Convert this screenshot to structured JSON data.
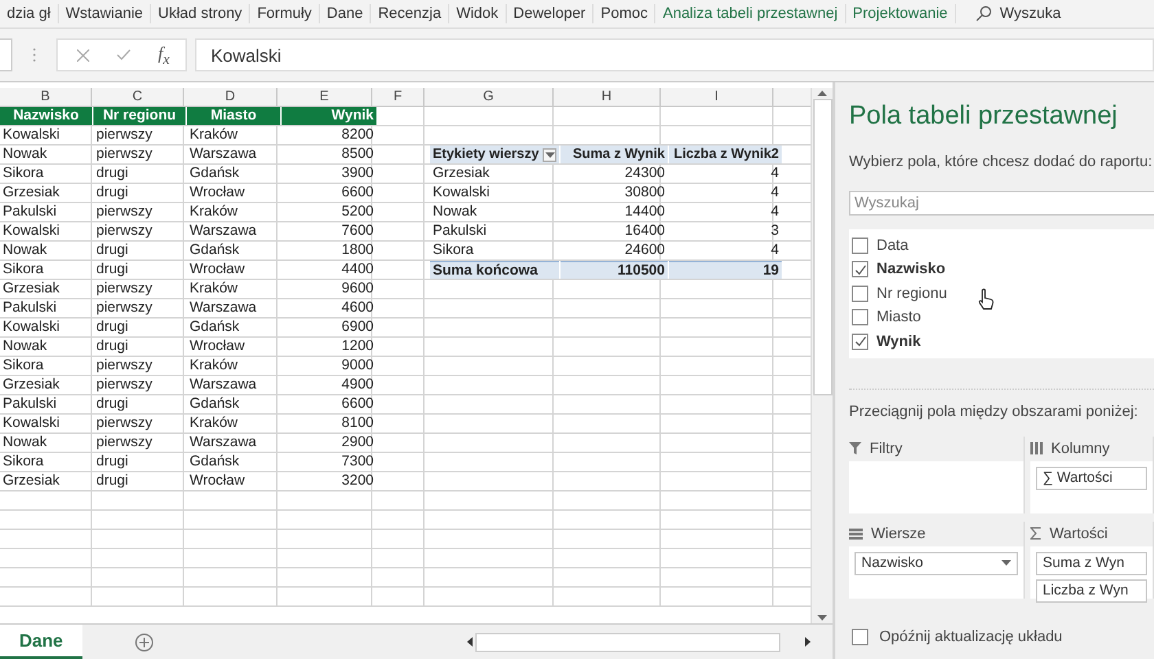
{
  "ribbon_tabs": [
    {
      "label": "dzia gł",
      "kind": "normal"
    },
    {
      "label": "Wstawianie",
      "kind": "normal"
    },
    {
      "label": "Układ strony",
      "kind": "normal"
    },
    {
      "label": "Formuły",
      "kind": "normal"
    },
    {
      "label": "Dane",
      "kind": "normal"
    },
    {
      "label": "Recenzja",
      "kind": "normal"
    },
    {
      "label": "Widok",
      "kind": "normal"
    },
    {
      "label": "Deweloper",
      "kind": "normal"
    },
    {
      "label": "Pomoc",
      "kind": "normal"
    },
    {
      "label": "Analiza tabeli przestawnej",
      "kind": "contextual"
    },
    {
      "label": "Projektowanie",
      "kind": "contextual"
    }
  ],
  "ribbon_search": {
    "label": "Wyszuka"
  },
  "formula_bar": {
    "function_label": "f$_{x}$",
    "value": "Kowalski"
  },
  "sheet": {
    "columns": [
      "B",
      "C",
      "D",
      "E",
      "F",
      "G",
      "H",
      "I"
    ],
    "header": [
      "Nazwisko",
      "Nr regionu",
      "Miasto",
      "Wynik"
    ],
    "rows": [
      [
        "Kowalski",
        "pierwszy",
        "Kraków",
        "8200"
      ],
      [
        "Nowak",
        "pierwszy",
        "Warszawa",
        "8500"
      ],
      [
        "Sikora",
        "drugi",
        "Gdańsk",
        "3900"
      ],
      [
        "Grzesiak",
        "drugi",
        "Wrocław",
        "6600"
      ],
      [
        "Pakulski",
        "pierwszy",
        "Kraków",
        "5200"
      ],
      [
        "Kowalski",
        "pierwszy",
        "Warszawa",
        "7600"
      ],
      [
        "Nowak",
        "drugi",
        "Gdańsk",
        "1800"
      ],
      [
        "Sikora",
        "drugi",
        "Wrocław",
        "4400"
      ],
      [
        "Grzesiak",
        "pierwszy",
        "Kraków",
        "9600"
      ],
      [
        "Pakulski",
        "pierwszy",
        "Warszawa",
        "4600"
      ],
      [
        "Kowalski",
        "drugi",
        "Gdańsk",
        "6900"
      ],
      [
        "Nowak",
        "drugi",
        "Wrocław",
        "1200"
      ],
      [
        "Sikora",
        "pierwszy",
        "Kraków",
        "9000"
      ],
      [
        "Grzesiak",
        "pierwszy",
        "Warszawa",
        "4900"
      ],
      [
        "Pakulski",
        "drugi",
        "Gdańsk",
        "6600"
      ],
      [
        "Kowalski",
        "pierwszy",
        "Kraków",
        "8100"
      ],
      [
        "Nowak",
        "pierwszy",
        "Warszawa",
        "2900"
      ],
      [
        "Sikora",
        "drugi",
        "Gdańsk",
        "7300"
      ],
      [
        "Grzesiak",
        "drugi",
        "Wrocław",
        "3200"
      ]
    ]
  },
  "pivot": {
    "columns": [
      "Etykiety wierszy",
      "Suma z Wynik",
      "Liczba z Wynik2"
    ],
    "rows": [
      {
        "label": "Grzesiak",
        "values": [
          "24300",
          "4"
        ]
      },
      {
        "label": "Kowalski",
        "values": [
          "30800",
          "4"
        ]
      },
      {
        "label": "Nowak",
        "values": [
          "14400",
          "4"
        ]
      },
      {
        "label": "Pakulski",
        "values": [
          "16400",
          "3"
        ]
      },
      {
        "label": "Sikora",
        "values": [
          "24600",
          "4"
        ]
      }
    ],
    "total": {
      "label": "Suma końcowa",
      "values": [
        "110500",
        "19"
      ]
    }
  },
  "sheet_tabs": [
    {
      "label": "Dane",
      "selected": true
    }
  ],
  "panel": {
    "title": "Pola tabeli przestawnej",
    "subtitle": "Wybierz pola, które chcesz dodać do raportu:",
    "search": {
      "placeholder": "Wyszukaj"
    },
    "fields": [
      {
        "label": "Data",
        "checked": false
      },
      {
        "label": "Nazwisko",
        "checked": true
      },
      {
        "label": "Nr regionu",
        "checked": false
      },
      {
        "label": "Miasto",
        "checked": false
      },
      {
        "label": "Wynik",
        "checked": true
      }
    ],
    "drag_hint": "Przeciągnij pola między obszarami poniżej:",
    "areas": [
      {
        "kind": "filters",
        "label": "Filtry"
      },
      {
        "kind": "columns",
        "label": "Kolumny",
        "items": [
          "∑ Wartości"
        ]
      },
      {
        "kind": "rows",
        "label": "Wiersze",
        "items": [
          "Nazwisko"
        ]
      },
      {
        "kind": "values",
        "label": "Wartości",
        "items": [
          "Suma z Wyn",
          "Liczba z Wyn"
        ]
      }
    ],
    "defer_update": {
      "label": "Opóźnij aktualizację układu",
      "checked": false
    }
  }
}
